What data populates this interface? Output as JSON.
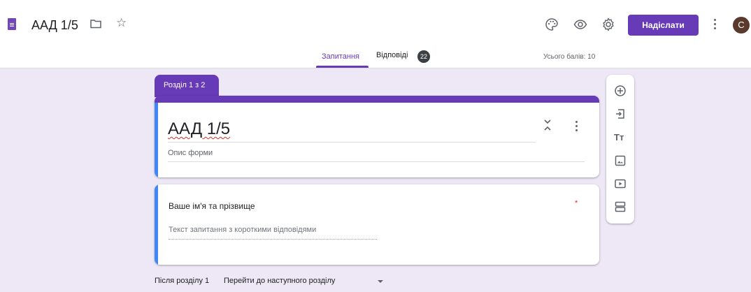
{
  "header": {
    "doc_title": "ААД 1/5",
    "send_label": "Надіслати",
    "avatar_letter": "C"
  },
  "tabs": {
    "questions": "Запитання",
    "responses": "Відповіді",
    "responses_count": "22"
  },
  "total_points": "Усього балів: 10",
  "section": {
    "tab_label": "Розділ 1 з 2",
    "form_title": "ААД 1/5",
    "description_placeholder": "Опис форми"
  },
  "question": {
    "title": "Ваше ім'я та прізвище",
    "required_marker": "*",
    "answer_placeholder": "Текст запитання з короткими відповідями"
  },
  "section_nav": {
    "after_label": "Після розділу 1",
    "goto_value": "Перейти до наступного розділу"
  },
  "toolbar": {
    "text_icon_glyph": "Tт"
  },
  "colors": {
    "accent": "#673ab7",
    "background": "#ede7f6",
    "focus_bar": "#4285f4",
    "required": "#d93025"
  },
  "icons": [
    "doc-icon",
    "folder-icon",
    "star-icon",
    "palette-icon",
    "eye-icon",
    "gear-icon",
    "more-vert-icon",
    "collapse-icon",
    "add-question-icon",
    "import-icon",
    "title-text-icon",
    "image-icon",
    "video-icon",
    "section-icon",
    "dropdown-arrow-icon"
  ]
}
